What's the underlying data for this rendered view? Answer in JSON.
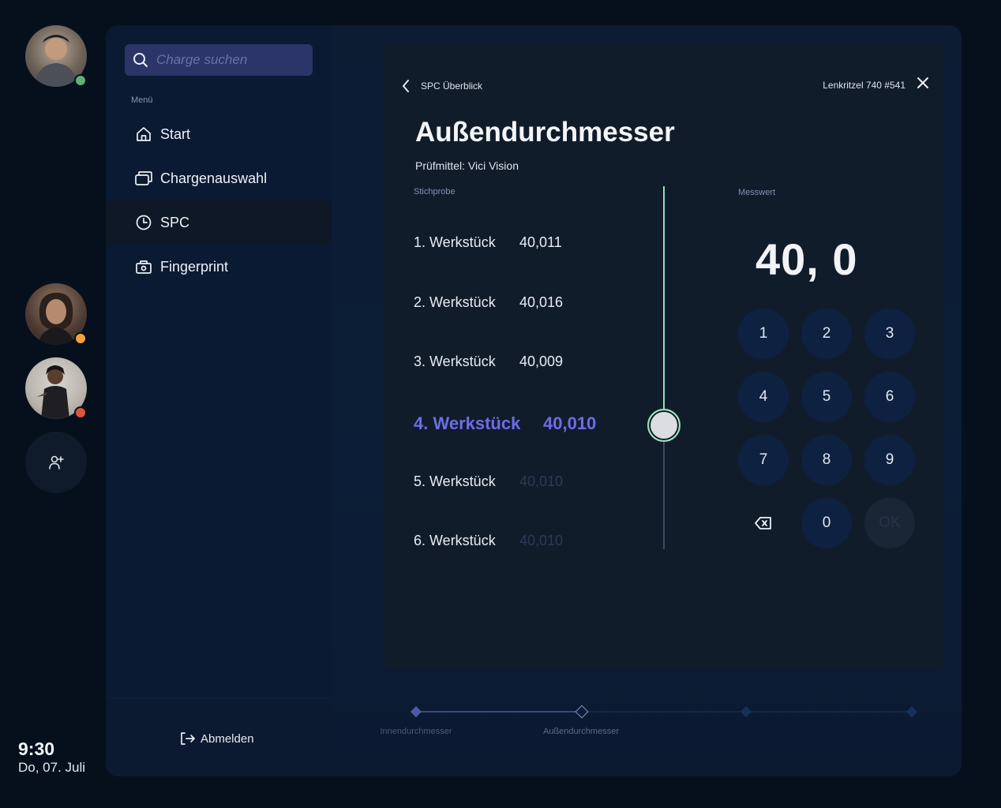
{
  "users": [
    {
      "name": "avatar-user-1",
      "status_color": "#5fb07a"
    },
    {
      "name": "avatar-user-2",
      "status_color": "#f5a23a"
    },
    {
      "name": "avatar-user-3",
      "status_color": "#e0533f"
    }
  ],
  "clock": {
    "time": "9:30",
    "date": "Do, 07. Juli"
  },
  "sidebar": {
    "search_placeholder": "Charge suchen",
    "menu_label": "Menü",
    "items": [
      {
        "label": "Start",
        "icon": "home-icon"
      },
      {
        "label": "Chargenauswahl",
        "icon": "stack-icon"
      },
      {
        "label": "SPC",
        "icon": "clock-icon",
        "active": true
      },
      {
        "label": "Fingerprint",
        "icon": "camera-icon"
      }
    ],
    "logout_label": "Abmelden"
  },
  "card": {
    "back_label": "SPC Überblick",
    "reference": "Lenkritzel 740 #541",
    "title": "Außendurchmesser",
    "subtitle": "Prüfmittel: Vici Vision",
    "sample_label": "Stichprobe",
    "measure_label": "Messwert",
    "rows": [
      {
        "name": "1. Werkstück",
        "value": "40,011",
        "state": "done"
      },
      {
        "name": "2. Werkstück",
        "value": "40,016",
        "state": "done"
      },
      {
        "name": "3. Werkstück",
        "value": "40,009",
        "state": "done"
      },
      {
        "name": "4. Werkstück",
        "value": "40,010",
        "state": "active"
      },
      {
        "name": "5. Werkstück",
        "value": "40,010",
        "state": "pending"
      },
      {
        "name": "6. Werkstück",
        "value": "40,010",
        "state": "pending"
      }
    ],
    "display_value": "40, 0",
    "keys": [
      "1",
      "2",
      "3",
      "4",
      "5",
      "6",
      "7",
      "8",
      "9",
      "0"
    ],
    "ok_label": "OK"
  },
  "stepper": {
    "steps": [
      "Innendurchmesser",
      "Außendurchmesser",
      "",
      ""
    ],
    "current": 1
  },
  "colors": {
    "accent": "#6b6ee8",
    "progress": "#8fe0b2"
  }
}
